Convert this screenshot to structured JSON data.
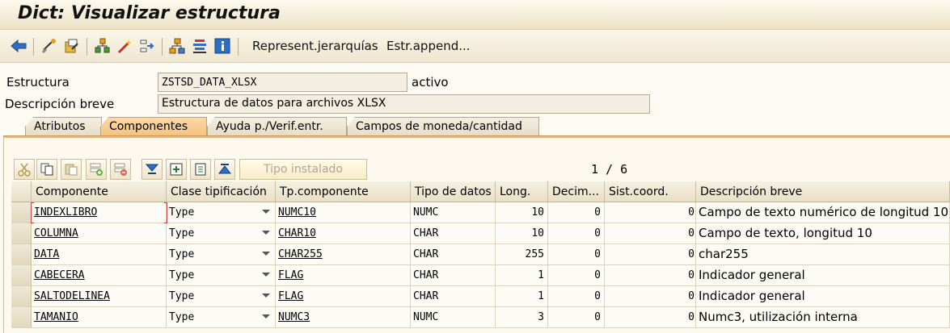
{
  "window": {
    "title": "Dict: Visualizar estructura"
  },
  "toolbar": {
    "icons": [
      "back-arrow-icon",
      "other-object-icon",
      "display-change-icon",
      "where-used-icon",
      "activate-icon",
      "navigate-icon",
      "hierarchy-icon",
      "stack-icon",
      "info-icon"
    ],
    "hierarchy_label": "Represent.jerarquías",
    "append_label": "Estr.append..."
  },
  "header": {
    "structure_label": "Estructura",
    "structure_value": "ZSTSD_DATA_XLSX",
    "status": "activo",
    "desc_label": "Descripción breve",
    "desc_value": "Estructura de datos para archivos XLSX"
  },
  "tabs": [
    {
      "label": "Atributos",
      "active": false
    },
    {
      "label": "Componentes",
      "active": true
    },
    {
      "label": "Ayuda p./Verif.entr.",
      "active": false
    },
    {
      "label": "Campos de moneda/cantidad",
      "active": false
    }
  ],
  "grid_toolbar": {
    "type_button": "Tipo instalado",
    "pager": "1 / 6"
  },
  "table": {
    "columns": [
      "Componente",
      "Clase tipificación",
      "Tp.componente",
      "Tipo de datos",
      "Long.",
      "Decim...",
      "Sist.coord.",
      "Descripción breve"
    ],
    "rows": [
      {
        "component": "INDEXLIBRO",
        "typing": "Type",
        "comp_type": "NUMC10",
        "data_type": "NUMC",
        "length": "10",
        "decimals": "0",
        "coord": "0",
        "description": "Campo de texto numérico de longitud 10"
      },
      {
        "component": "COLUMNA",
        "typing": "Type",
        "comp_type": "CHAR10",
        "data_type": "CHAR",
        "length": "10",
        "decimals": "0",
        "coord": "0",
        "description": "Campo de texto, longitud 10"
      },
      {
        "component": "DATA",
        "typing": "Type",
        "comp_type": "CHAR255",
        "data_type": "CHAR",
        "length": "255",
        "decimals": "0",
        "coord": "0",
        "description": "char255"
      },
      {
        "component": "CABECERA",
        "typing": "Type",
        "comp_type": "FLAG",
        "data_type": "CHAR",
        "length": "1",
        "decimals": "0",
        "coord": "0",
        "description": "Indicador general"
      },
      {
        "component": "SALTODELINEA",
        "typing": "Type",
        "comp_type": "FLAG",
        "data_type": "CHAR",
        "length": "1",
        "decimals": "0",
        "coord": "0",
        "description": "Indicador general"
      },
      {
        "component": "TAMANIO",
        "typing": "Type",
        "comp_type": "NUMC3",
        "data_type": "NUMC",
        "length": "3",
        "decimals": "0",
        "coord": "0",
        "description": "Numc3, utilización interna"
      }
    ]
  },
  "colors": {
    "active_tab": "#f3c27f",
    "accent_blue": "#1f5fb0"
  }
}
